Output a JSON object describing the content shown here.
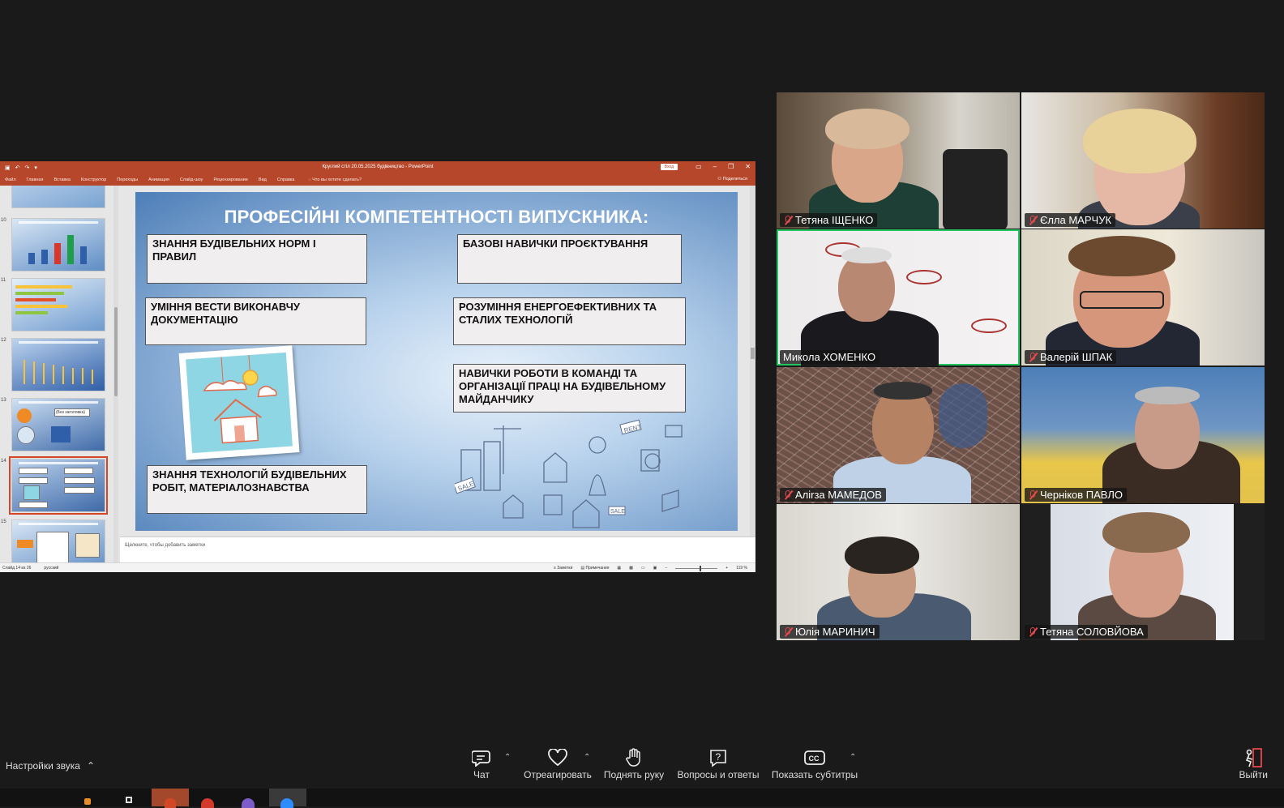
{
  "powerpoint": {
    "window_title": "Круглий стіл 20.05.2025 будівництво - PowerPoint",
    "sign_in": "Вход",
    "share": "Поделиться",
    "menu": [
      "Файл",
      "Главная",
      "Вставка",
      "Конструктор",
      "Переходы",
      "Анимация",
      "Слайд-шоу",
      "Рецензирование",
      "Вид",
      "Справка"
    ],
    "tell_me": "Что вы хотите сделать?",
    "thumbnail_numbers": [
      "10",
      "11",
      "12",
      "13",
      "14",
      "15"
    ],
    "thumbnail_tooltip": "(Без заголовка)",
    "notes_placeholder": "Щелкните, чтобы добавить заметки",
    "status": {
      "slide_of": "Слайд 14 из 26",
      "language": "русский",
      "notes": "Заметки",
      "comments": "Примечания",
      "zoom": "119 %"
    }
  },
  "slide": {
    "title": "ПРОФЕСІЙНІ КОМПЕТЕНТНОСТІ ВИПУСКНИКА:",
    "boxes": [
      "ЗНАННЯ БУДІВЕЛЬНИХ НОРМ І ПРАВИЛ",
      "БАЗОВІ НАВИЧКИ ПРОЄКТУВАННЯ",
      "УМІННЯ ВЕСТИ ВИКОНАВЧУ ДОКУМЕНТАЦІЮ",
      "РОЗУМІННЯ ЕНЕРГОЕФЕКТИВНИХ ТА СТАЛИХ ТЕХНОЛОГІЙ",
      "НАВИЧКИ РОБОТИ В КОМАНДІ ТА ОРГАНІЗАЦІЇ ПРАЦІ НА БУДІВЕЛЬНОМУ МАЙДАНЧИКУ",
      "ЗНАННЯ ТЕХНОЛОГІЙ БУДІВЕЛЬНИХ РОБІТ, МАТЕРІАЛОЗНАВСТВА"
    ],
    "illustration_labels": [
      "RENT",
      "SALE",
      "SALE"
    ]
  },
  "participants": [
    {
      "name": "Тетяна ІЩЕНКО",
      "muted": true
    },
    {
      "name": "Єлла МАРЧУК",
      "muted": true
    },
    {
      "name": "Микола ХОМЕНКО",
      "muted": false,
      "speaking": true
    },
    {
      "name": "Валерій ШПАК",
      "muted": true
    },
    {
      "name": "Аліrза МАМЕДОВ",
      "muted": true
    },
    {
      "name": "Черніков ПАВЛО",
      "muted": true
    },
    {
      "name": "Юлія МАРИНИЧ",
      "muted": true
    },
    {
      "name": "Тетяна СОЛОВЙОВА",
      "muted": true
    }
  ],
  "toolbar": {
    "audio_settings": "Настройки звука",
    "chat": "Чат",
    "react": "Отреагировать",
    "raise_hand": "Поднять руку",
    "qa": "Вопросы и ответы",
    "captions": "Показать субтитры",
    "leave": "Выйти"
  },
  "colors": {
    "ppt_accent": "#b7472a",
    "speaking_outline": "#22c55e",
    "muted_red": "#e5484d"
  }
}
